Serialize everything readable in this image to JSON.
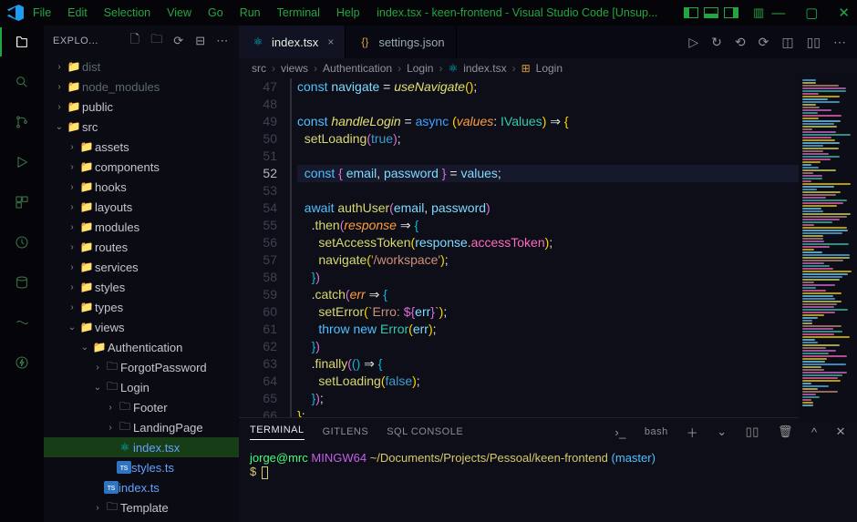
{
  "menu": [
    "File",
    "Edit",
    "Selection",
    "View",
    "Go",
    "Run",
    "Terminal",
    "Help"
  ],
  "title": "index.tsx - keen-frontend - Visual Studio Code [Unsup...",
  "sidebar_header": "EXPLO...",
  "tree": [
    {
      "d": 0,
      "arrow": "›",
      "icon": "📁",
      "cls": "pink",
      "label": "dist",
      "muted": true
    },
    {
      "d": 0,
      "arrow": "›",
      "icon": "📁",
      "cls": "green",
      "label": "node_modules",
      "muted": true
    },
    {
      "d": 0,
      "arrow": "›",
      "icon": "📁",
      "cls": "cyan",
      "label": "public"
    },
    {
      "d": 0,
      "arrow": "⌄",
      "icon": "📁",
      "cls": "yellow",
      "label": "src"
    },
    {
      "d": 1,
      "arrow": "›",
      "icon": "📁",
      "cls": "yellow",
      "label": "assets"
    },
    {
      "d": 1,
      "arrow": "›",
      "icon": "📁",
      "cls": "yellow",
      "label": "components"
    },
    {
      "d": 1,
      "arrow": "›",
      "icon": "📁",
      "cls": "purple",
      "label": "hooks"
    },
    {
      "d": 1,
      "arrow": "›",
      "icon": "📁",
      "cls": "purple",
      "label": "layouts"
    },
    {
      "d": 1,
      "arrow": "›",
      "icon": "📁",
      "cls": "pink",
      "label": "modules"
    },
    {
      "d": 1,
      "arrow": "›",
      "icon": "📁",
      "cls": "green",
      "label": "routes"
    },
    {
      "d": 1,
      "arrow": "›",
      "icon": "📁",
      "cls": "cyan",
      "label": "services"
    },
    {
      "d": 1,
      "arrow": "›",
      "icon": "📁",
      "cls": "cyan",
      "label": "styles"
    },
    {
      "d": 1,
      "arrow": "›",
      "icon": "📁",
      "cls": "teal",
      "label": "types"
    },
    {
      "d": 1,
      "arrow": "⌄",
      "icon": "📁",
      "cls": "red",
      "label": "views"
    },
    {
      "d": 2,
      "arrow": "⌄",
      "icon": "📁",
      "cls": "folder",
      "label": "Authentication"
    },
    {
      "d": 3,
      "arrow": "›",
      "icon": "🗀",
      "cls": "grey",
      "label": "ForgotPassword"
    },
    {
      "d": 3,
      "arrow": "⌄",
      "icon": "🗀",
      "cls": "grey",
      "label": "Login"
    },
    {
      "d": 4,
      "arrow": "›",
      "icon": "🗀",
      "cls": "grey",
      "label": "Footer"
    },
    {
      "d": 4,
      "arrow": "›",
      "icon": "🗀",
      "cls": "grey",
      "label": "LandingPage"
    },
    {
      "d": 4,
      "arrow": "",
      "icon": "⚛",
      "cls": "react",
      "label": "index.tsx",
      "sel": true,
      "blue": true
    },
    {
      "d": 4,
      "arrow": "",
      "icon": "TS",
      "cls": "ts",
      "label": "styles.ts",
      "blue": true
    },
    {
      "d": 3,
      "arrow": "",
      "icon": "TS",
      "cls": "ts",
      "label": "index.ts",
      "blue": true
    },
    {
      "d": 3,
      "arrow": "›",
      "icon": "🗀",
      "cls": "grey",
      "label": "Template"
    }
  ],
  "tabs": [
    {
      "icon": "⚛",
      "cls": "react",
      "label": "index.tsx",
      "active": true
    },
    {
      "icon": "{}",
      "cls": "yellow",
      "label": "settings.json"
    }
  ],
  "breadcrumbs": [
    "src",
    "views",
    "Authentication",
    "Login",
    "index.tsx",
    "Login"
  ],
  "line_start": 47,
  "highlight_line": 52,
  "code": [
    [
      [
        "tok-kw",
        "const "
      ],
      [
        "tok-var",
        "navigate"
      ],
      [
        "tok-op",
        " = "
      ],
      [
        "tok-fn",
        "useNavigate"
      ],
      [
        "tok-br",
        "()"
      ],
      [
        "tok-op",
        ";"
      ]
    ],
    [],
    [
      [
        "tok-kw",
        "const "
      ],
      [
        "tok-fn",
        "handleLogin"
      ],
      [
        "tok-op",
        " = "
      ],
      [
        "tok-kw2",
        "async "
      ],
      [
        "tok-br",
        "("
      ],
      [
        "tok-param",
        "values"
      ],
      [
        "tok-op",
        ": "
      ],
      [
        "tok-type",
        "IValues"
      ],
      [
        "tok-br",
        ")"
      ],
      [
        "tok-op",
        " ⇒ "
      ],
      [
        "tok-br",
        "{"
      ]
    ],
    [
      [
        "",
        "  "
      ],
      [
        "tok-call",
        "setLoading"
      ],
      [
        "tok-br2",
        "("
      ],
      [
        "tok-bool",
        "true"
      ],
      [
        "tok-br2",
        ")"
      ],
      [
        "tok-op",
        ";"
      ]
    ],
    [],
    [
      [
        "",
        "  "
      ],
      [
        "tok-kw",
        "const "
      ],
      [
        "tok-br2",
        "{"
      ],
      [
        "tok-var",
        " email"
      ],
      [
        "tok-op",
        ", "
      ],
      [
        "tok-var",
        "password "
      ],
      [
        "tok-br2",
        "}"
      ],
      [
        "tok-op",
        " = "
      ],
      [
        "tok-var",
        "values"
      ],
      [
        "tok-op",
        ";"
      ]
    ],
    [],
    [
      [
        "",
        "  "
      ],
      [
        "tok-kw",
        "await "
      ],
      [
        "tok-call",
        "authUser"
      ],
      [
        "tok-br2",
        "("
      ],
      [
        "tok-var",
        "email"
      ],
      [
        "tok-op",
        ", "
      ],
      [
        "tok-var",
        "password"
      ],
      [
        "tok-br2",
        ")"
      ]
    ],
    [
      [
        "",
        "    "
      ],
      [
        "tok-op",
        "."
      ],
      [
        "tok-call",
        "then"
      ],
      [
        "tok-br2",
        "("
      ],
      [
        "tok-param",
        "response"
      ],
      [
        "tok-op",
        " ⇒ "
      ],
      [
        "tok-br3",
        "{"
      ]
    ],
    [
      [
        "",
        "      "
      ],
      [
        "tok-call",
        "setAccessToken"
      ],
      [
        "tok-br",
        "("
      ],
      [
        "tok-var",
        "response"
      ],
      [
        "tok-op",
        "."
      ],
      [
        "tok-prop",
        "accessToken"
      ],
      [
        "tok-br",
        ")"
      ],
      [
        "tok-op",
        ";"
      ]
    ],
    [
      [
        "",
        "      "
      ],
      [
        "tok-call",
        "navigate"
      ],
      [
        "tok-br",
        "("
      ],
      [
        "tok-str",
        "'/workspace'"
      ],
      [
        "tok-br",
        ")"
      ],
      [
        "tok-op",
        ";"
      ]
    ],
    [
      [
        "",
        "    "
      ],
      [
        "tok-br3",
        "}"
      ],
      [
        "tok-br2",
        ")"
      ]
    ],
    [
      [
        "",
        "    "
      ],
      [
        "tok-op",
        "."
      ],
      [
        "tok-call",
        "catch"
      ],
      [
        "tok-br2",
        "("
      ],
      [
        "tok-param",
        "err"
      ],
      [
        "tok-op",
        " ⇒ "
      ],
      [
        "tok-br3",
        "{"
      ]
    ],
    [
      [
        "",
        "      "
      ],
      [
        "tok-call",
        "setError"
      ],
      [
        "tok-br",
        "("
      ],
      [
        "tok-str",
        "`Erro: "
      ],
      [
        "tok-br2",
        "${"
      ],
      [
        "tok-var",
        "err"
      ],
      [
        "tok-br2",
        "}"
      ],
      [
        "tok-str",
        "`"
      ],
      [
        "tok-br",
        ")"
      ],
      [
        "tok-op",
        ";"
      ]
    ],
    [
      [
        "",
        "      "
      ],
      [
        "tok-kw",
        "throw "
      ],
      [
        "tok-new",
        "new "
      ],
      [
        "tok-type",
        "Error"
      ],
      [
        "tok-br",
        "("
      ],
      [
        "tok-var",
        "err"
      ],
      [
        "tok-br",
        ")"
      ],
      [
        "tok-op",
        ";"
      ]
    ],
    [
      [
        "",
        "    "
      ],
      [
        "tok-br3",
        "}"
      ],
      [
        "tok-br2",
        ")"
      ]
    ],
    [
      [
        "",
        "    "
      ],
      [
        "tok-op",
        "."
      ],
      [
        "tok-call",
        "finally"
      ],
      [
        "tok-br2",
        "("
      ],
      [
        "tok-br3",
        "()"
      ],
      [
        "tok-op",
        " ⇒ "
      ],
      [
        "tok-br3",
        "{"
      ]
    ],
    [
      [
        "",
        "      "
      ],
      [
        "tok-call",
        "setLoading"
      ],
      [
        "tok-br",
        "("
      ],
      [
        "tok-bool",
        "false"
      ],
      [
        "tok-br",
        ")"
      ],
      [
        "tok-op",
        ";"
      ]
    ],
    [
      [
        "",
        "    "
      ],
      [
        "tok-br3",
        "}"
      ],
      [
        "tok-br2",
        ")"
      ],
      [
        "tok-op",
        ";"
      ]
    ],
    [
      [
        "tok-br",
        "}"
      ],
      [
        "tok-op",
        ";"
      ]
    ]
  ],
  "terminal_tabs": [
    "TERMINAL",
    "GITLENS",
    "SQL CONSOLE"
  ],
  "terminal_shell": "bash",
  "shell": {
    "user": "jorge@mrc",
    "sys": "MINGW64",
    "path": "~/Documents/Projects/Pessoal/keen-frontend",
    "branch": "(master)",
    "prompt": "$"
  },
  "colors": {
    "accent": "#23a640"
  }
}
